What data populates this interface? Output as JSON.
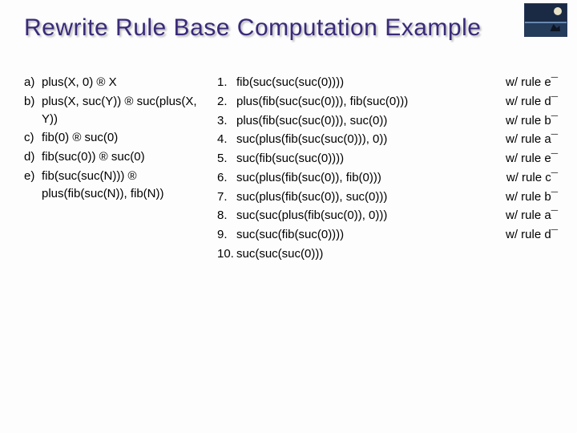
{
  "title": "Rewrite Rule Base Computation Example",
  "arrow": "®",
  "down": "¯",
  "rules": [
    {
      "label": "a)",
      "text": "plus(X, 0) ® X"
    },
    {
      "label": "b)",
      "text": "plus(X, suc(Y)) ® suc(plus(X, Y))"
    },
    {
      "label": "c)",
      "text": "fib(0) ® suc(0)"
    },
    {
      "label": "d)",
      "text": "fib(suc(0)) ® suc(0)"
    },
    {
      "label": "e)",
      "text": "fib(suc(suc(N))) ® plus(fib(suc(N)), fib(N))"
    }
  ],
  "sequence": [
    {
      "n": "1.",
      "expr": "fib(suc(suc(suc(0))))",
      "note": "w/ rule e¯"
    },
    {
      "n": "2.",
      "expr": "plus(fib(suc(suc(0))), fib(suc(0)))",
      "note": "w/ rule d¯"
    },
    {
      "n": "3.",
      "expr": "plus(fib(suc(suc(0))), suc(0))",
      "note": "w/ rule b¯"
    },
    {
      "n": "4.",
      "expr": "suc(plus(fib(suc(suc(0))), 0))",
      "note": "w/ rule a¯"
    },
    {
      "n": "5.",
      "expr": "suc(fib(suc(suc(0))))",
      "note": "w/ rule e¯"
    },
    {
      "n": "6.",
      "expr": "suc(plus(fib(suc(0)), fib(0)))",
      "note": "w/ rule c¯"
    },
    {
      "n": "7.",
      "expr": "suc(plus(fib(suc(0)), suc(0)))",
      "note": "w/ rule b¯"
    },
    {
      "n": "8.",
      "expr": "suc(suc(plus(fib(suc(0)), 0)))",
      "note": "w/ rule a¯"
    },
    {
      "n": "9.",
      "expr": "suc(suc(fib(suc(0))))",
      "note": "w/ rule d¯"
    },
    {
      "n": "10.",
      "expr": "suc(suc(suc(0)))",
      "note": ""
    }
  ]
}
